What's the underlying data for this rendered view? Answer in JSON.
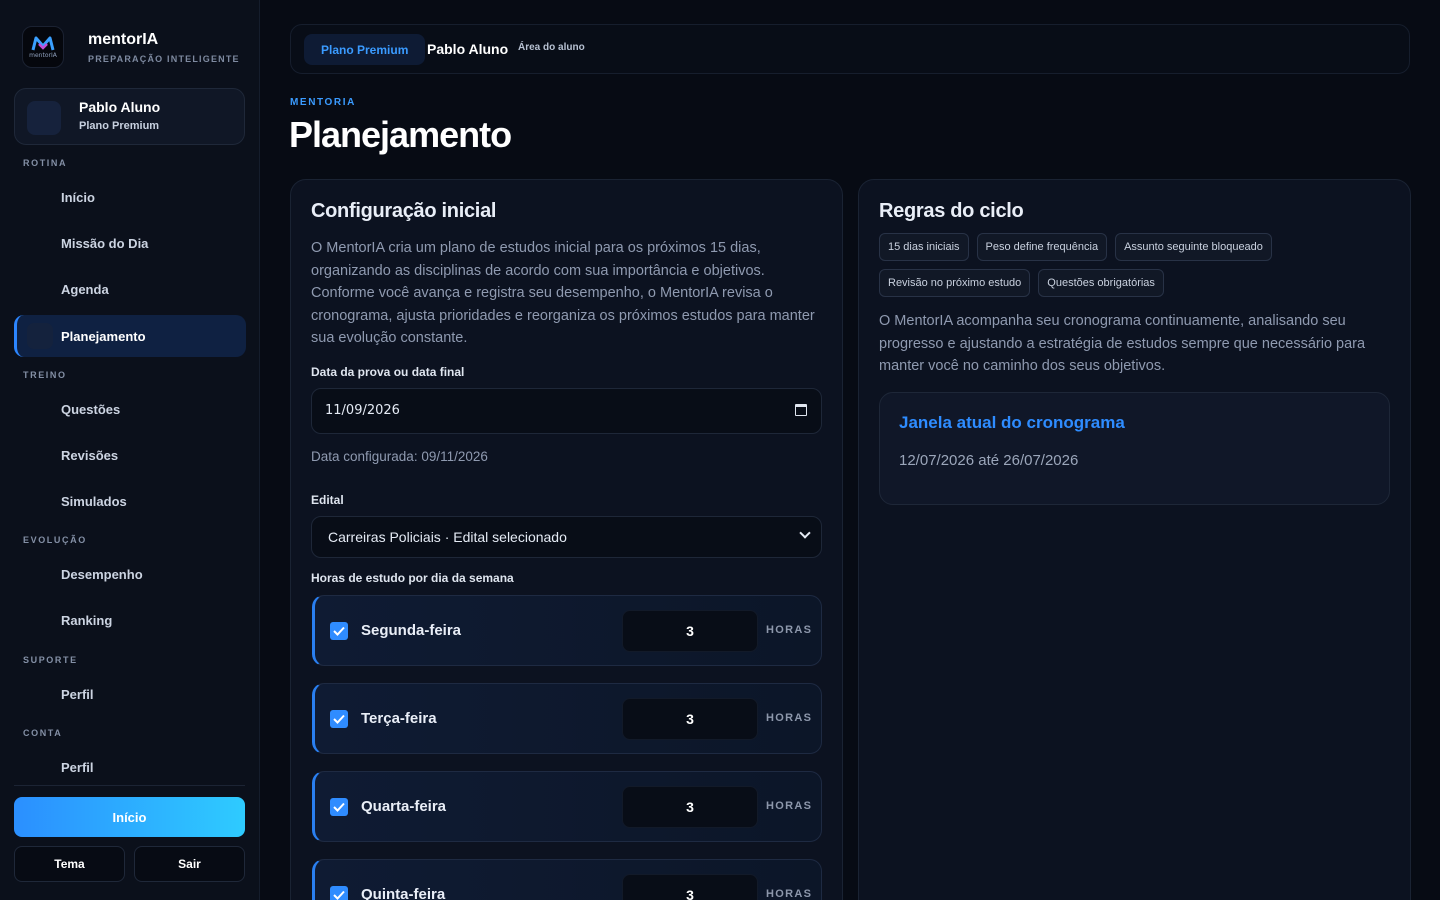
{
  "brand": {
    "name": "mentorIA",
    "subtitle": "PREPARAÇÃO INTELIGENTE",
    "logo_text": "mentorIA"
  },
  "user": {
    "name": "Pablo Aluno",
    "plan": "Plano Premium"
  },
  "sidebar": {
    "sections": [
      {
        "label": "ROTINA"
      },
      {
        "label": "TREINO"
      },
      {
        "label": "EVOLUÇÃO"
      },
      {
        "label": "SUPORTE"
      },
      {
        "label": "CONTA"
      }
    ],
    "items": [
      {
        "label": "Início",
        "active": false
      },
      {
        "label": "Missão do Dia",
        "active": false
      },
      {
        "label": "Agenda",
        "active": false
      },
      {
        "label": "Planejamento",
        "active": true
      },
      {
        "label": "Questões",
        "active": false
      },
      {
        "label": "Revisões",
        "active": false
      },
      {
        "label": "Simulados",
        "active": false
      },
      {
        "label": "Desempenho",
        "active": false
      },
      {
        "label": "Ranking",
        "active": false
      },
      {
        "label": "Perfil",
        "active": false
      },
      {
        "label": "Perfil",
        "active": false
      }
    ],
    "cta_label": "Início",
    "theme_label": "Tema",
    "logout_label": "Sair"
  },
  "topbar": {
    "plan": "Plano Premium",
    "user": "Pablo Aluno",
    "area": "Área do aluno"
  },
  "page": {
    "kicker": "MENTORIA",
    "title": "Planejamento"
  },
  "config": {
    "title": "Configuração inicial",
    "description": "O MentorIA cria um plano de estudos inicial para os próximos 15 dias, organizando as disciplinas de acordo com sua importância e objetivos. Conforme você avança e registra seu desempenho, o MentorIA revisa o cronograma, ajusta prioridades e reorganiza os próximos estudos para manter sua evolução constante.",
    "date_label": "Data da prova ou data final",
    "date_value": "11/09/2026",
    "date_note": "Data configurada: 09/11/2026",
    "edital_label": "Edital",
    "edital_value": "Carreiras Policiais · Edital selecionado",
    "hours_label": "Horas de estudo por dia da semana",
    "hours_unit": "HORAS",
    "days": [
      {
        "name": "Segunda-feira",
        "hours": "3",
        "checked": true
      },
      {
        "name": "Terça-feira",
        "hours": "3",
        "checked": true
      },
      {
        "name": "Quarta-feira",
        "hours": "3",
        "checked": true
      },
      {
        "name": "Quinta-feira",
        "hours": "3",
        "checked": true
      }
    ]
  },
  "rules": {
    "title": "Regras do ciclo",
    "chips_row1": [
      "15 dias iniciais",
      "Peso define frequência",
      "Assunto seguinte bloqueado"
    ],
    "chips_row2": [
      "Revisão no próximo estudo",
      "Questões obrigatórias"
    ],
    "description": "O MentorIA acompanha seu cronograma continuamente, analisando seu progresso e ajustando a estratégia de estudos sempre que necessário para manter você no caminho dos seus objetivos.",
    "window_title": "Janela atual do cronograma",
    "window_range": "12/07/2026 até 26/07/2026"
  },
  "colors": {
    "accent": "#2e8cff",
    "background": "#070b14",
    "card": "#0c1220"
  }
}
